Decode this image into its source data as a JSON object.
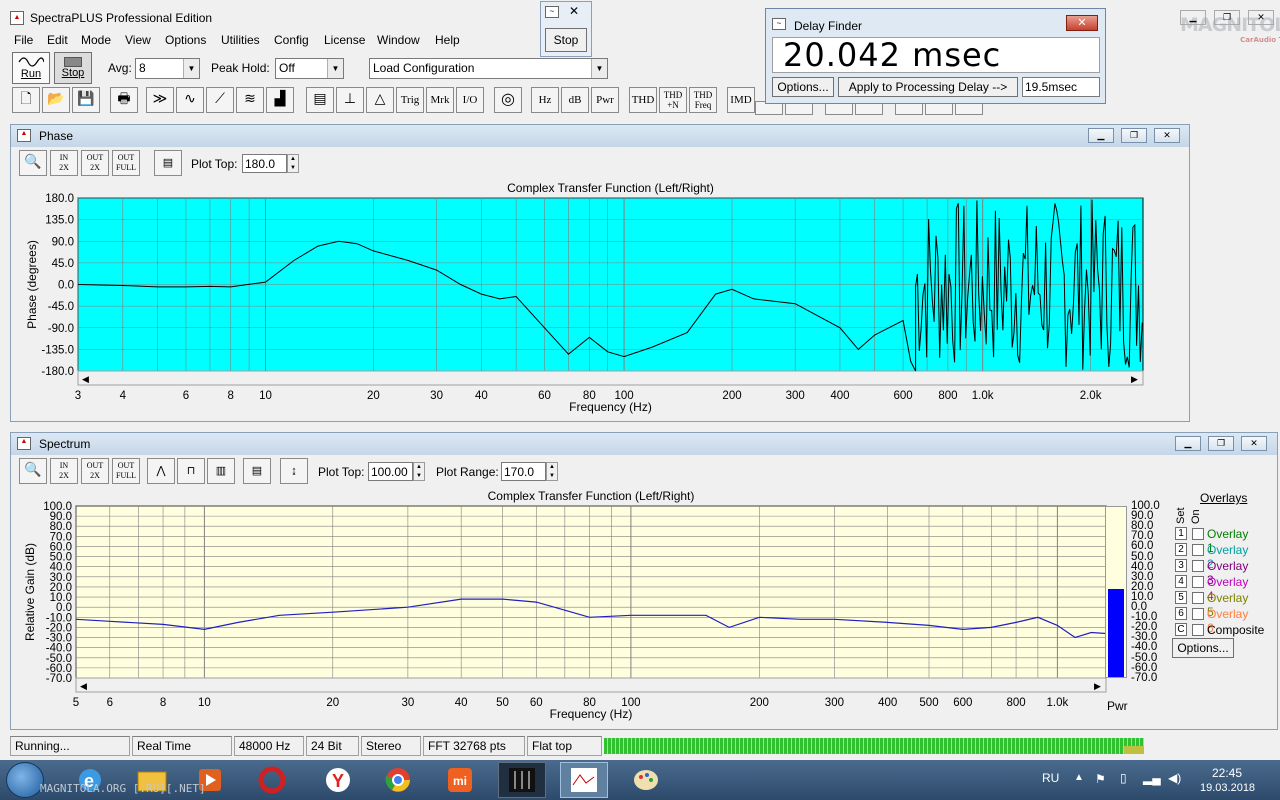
{
  "app": {
    "title": "SpectraPLUS Professional Edition"
  },
  "menu": [
    "File",
    "Edit",
    "Mode",
    "View",
    "Options",
    "Utilities",
    "Config",
    "License",
    "Window",
    "Help"
  ],
  "toolbar": {
    "run_label": "Run",
    "stop_label": "Stop",
    "avg_label": "Avg:",
    "avg_value": "8",
    "peak_hold_label": "Peak Hold:",
    "peak_hold_value": "Off",
    "load_config_value": "Load Configuration",
    "text_buttons": [
      "Trig",
      "Mrk",
      "I/O",
      "Hz",
      "dB",
      "Pwr",
      "THD",
      "THD +N",
      "THD Freq",
      "IMD"
    ]
  },
  "stop_popup": {
    "label": "Stop"
  },
  "delay_finder": {
    "title": "Delay Finder",
    "value": "20.042 msec",
    "options_label": "Options...",
    "apply_label": "Apply to Processing Delay -->",
    "delay_input": "19.5",
    "delay_unit": "msec"
  },
  "watermark": {
    "text": "MAGNITOLA",
    "sub": "CarAudio Team"
  },
  "phase": {
    "title": "Phase",
    "plot_top_label": "Plot Top:",
    "plot_top_value": "180.0",
    "chart_title": "Complex Transfer Function (Left/Right)",
    "ylabel": "Phase (degrees)",
    "xlabel": "Frequency (Hz)",
    "yticks": [
      "180.0",
      "135.0",
      "90.0",
      "45.0",
      "0.0",
      "-45.0",
      "-90.0",
      "-135.0",
      "-180.0"
    ],
    "xticks": [
      "3",
      "4",
      "6",
      "8",
      "10",
      "20",
      "30",
      "40",
      "60",
      "80",
      "100",
      "200",
      "300",
      "400",
      "600",
      "800",
      "1.0k",
      "2.0k"
    ],
    "bg": "#00ffff"
  },
  "spectrum": {
    "title": "Spectrum",
    "plot_top_label": "Plot Top:",
    "plot_top_value": "100.00",
    "plot_range_label": "Plot Range:",
    "plot_range_value": "170.0",
    "chart_title": "Complex Transfer Function (Left/Right)",
    "ylabel": "Relative Gain (dB)",
    "xlabel": "Frequency (Hz)",
    "yticks": [
      "100.0",
      "90.0",
      "80.0",
      "70.0",
      "60.0",
      "50.0",
      "40.0",
      "30.0",
      "20.0",
      "10.0",
      "0.0",
      "-10.0",
      "-20.0",
      "-30.0",
      "-40.0",
      "-50.0",
      "-60.0",
      "-70.0"
    ],
    "xticks": [
      "5",
      "6",
      "8",
      "10",
      "20",
      "30",
      "40",
      "50",
      "60",
      "80",
      "100",
      "200",
      "300",
      "400",
      "500",
      "600",
      "800",
      "1.0k"
    ],
    "pwr_label": "Pwr",
    "bg": "#ffffe0"
  },
  "overlays": {
    "title": "Overlays",
    "set_label": "Set",
    "on_label": "On",
    "items": [
      {
        "n": "1",
        "label": "Overlay 1",
        "color": "#008000"
      },
      {
        "n": "2",
        "label": "Overlay 2",
        "color": "#00a0a0"
      },
      {
        "n": "3",
        "label": "Overlay 3",
        "color": "#800080"
      },
      {
        "n": "4",
        "label": "Overlay 4",
        "color": "#c000c0"
      },
      {
        "n": "5",
        "label": "Overlay 5",
        "color": "#808000"
      },
      {
        "n": "6",
        "label": "Overlay 6",
        "color": "#ff8040"
      },
      {
        "n": "C",
        "label": "Composite",
        "color": "#000000"
      }
    ],
    "options_label": "Options..."
  },
  "status": [
    "Running...",
    "Real Time",
    "48000 Hz",
    "24 Bit",
    "Stereo",
    "FFT 32768 pts",
    "Flat top"
  ],
  "taskbar": {
    "lang": "RU",
    "time": "22:45",
    "date": "19.03.2018",
    "watermark_text": "MAGNITOLA.ORG [.RU][.NET]"
  },
  "chart_data": [
    {
      "type": "line",
      "title": "Complex Transfer Function (Left/Right)",
      "xlabel": "Frequency (Hz)",
      "ylabel": "Phase (degrees)",
      "xscale": "log",
      "xlim": [
        3,
        2800
      ],
      "ylim": [
        -180,
        180
      ],
      "series": [
        {
          "x": [
            3,
            4,
            5,
            6,
            7,
            8,
            10,
            12,
            14,
            16,
            18,
            20,
            25,
            30,
            35,
            40,
            45,
            50,
            60,
            70,
            80,
            90,
            100,
            120,
            150,
            180,
            200,
            230,
            300,
            400,
            450,
            500,
            600,
            630,
            650
          ],
          "y": [
            0,
            -2,
            -5,
            -5,
            -4,
            -5,
            5,
            50,
            80,
            90,
            85,
            70,
            50,
            30,
            0,
            -20,
            -30,
            -25,
            -90,
            -145,
            -110,
            -140,
            -150,
            -130,
            -100,
            -20,
            -10,
            -30,
            -40,
            -90,
            -135,
            -105,
            -75,
            -160,
            -180
          ]
        }
      ]
    },
    {
      "type": "line",
      "title": "Complex Transfer Function (Left/Right)",
      "xlabel": "Frequency (Hz)",
      "ylabel": "Relative Gain (dB)",
      "xscale": "log",
      "xlim": [
        5,
        1300
      ],
      "ylim": [
        -70,
        100
      ],
      "series": [
        {
          "x": [
            5,
            6,
            8,
            10,
            12,
            15,
            20,
            30,
            40,
            50,
            60,
            70,
            80,
            100,
            150,
            170,
            200,
            250,
            300,
            400,
            500,
            600,
            700,
            800,
            900,
            1000,
            1100,
            1200,
            1300
          ],
          "y": [
            -12,
            -14,
            -17,
            -22,
            -15,
            -8,
            -5,
            0,
            8,
            8,
            5,
            -3,
            -10,
            -8,
            -8,
            -20,
            -10,
            -12,
            -12,
            -15,
            -18,
            -22,
            -20,
            -15,
            -10,
            -18,
            -30,
            -25,
            -26
          ]
        }
      ]
    }
  ]
}
